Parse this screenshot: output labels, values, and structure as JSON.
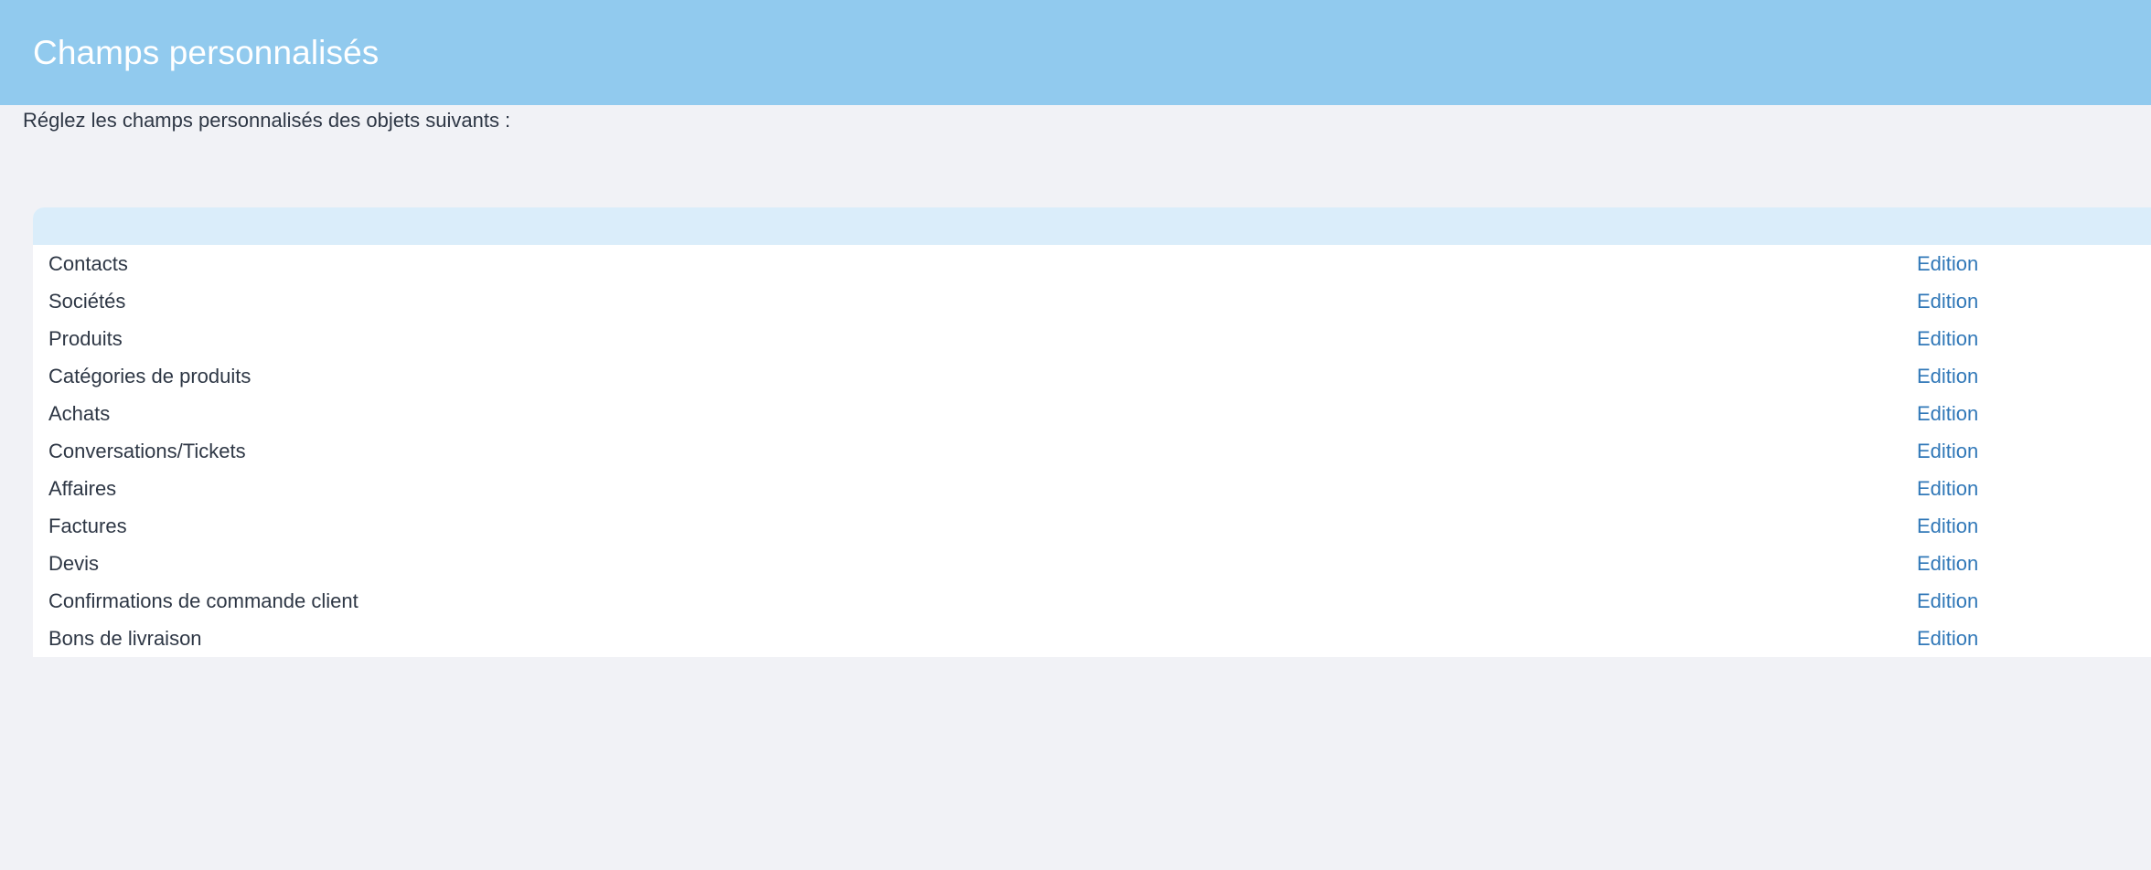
{
  "header": {
    "title": "Champs personnalisés",
    "background_color": "#91caee",
    "title_color": "#ffffff"
  },
  "page": {
    "background_color": "#f1f2f6",
    "intro_text": "Réglez les champs personnalisés des objets suivants :"
  },
  "card": {
    "strip_color": "#daedfa",
    "body_color": "#ffffff",
    "action_color": "#3178b8",
    "label_color": "#2e3745",
    "rows": [
      {
        "label": "Contacts",
        "action": "Edition"
      },
      {
        "label": "Sociétés",
        "action": "Edition"
      },
      {
        "label": "Produits",
        "action": "Edition"
      },
      {
        "label": "Catégories de produits",
        "action": "Edition"
      },
      {
        "label": "Achats",
        "action": "Edition"
      },
      {
        "label": "Conversations/Tickets",
        "action": "Edition"
      },
      {
        "label": "Affaires",
        "action": "Edition"
      },
      {
        "label": "Factures",
        "action": "Edition"
      },
      {
        "label": "Devis",
        "action": "Edition"
      },
      {
        "label": "Confirmations de commande client",
        "action": "Edition"
      },
      {
        "label": "Bons de livraison",
        "action": "Edition"
      }
    ]
  }
}
